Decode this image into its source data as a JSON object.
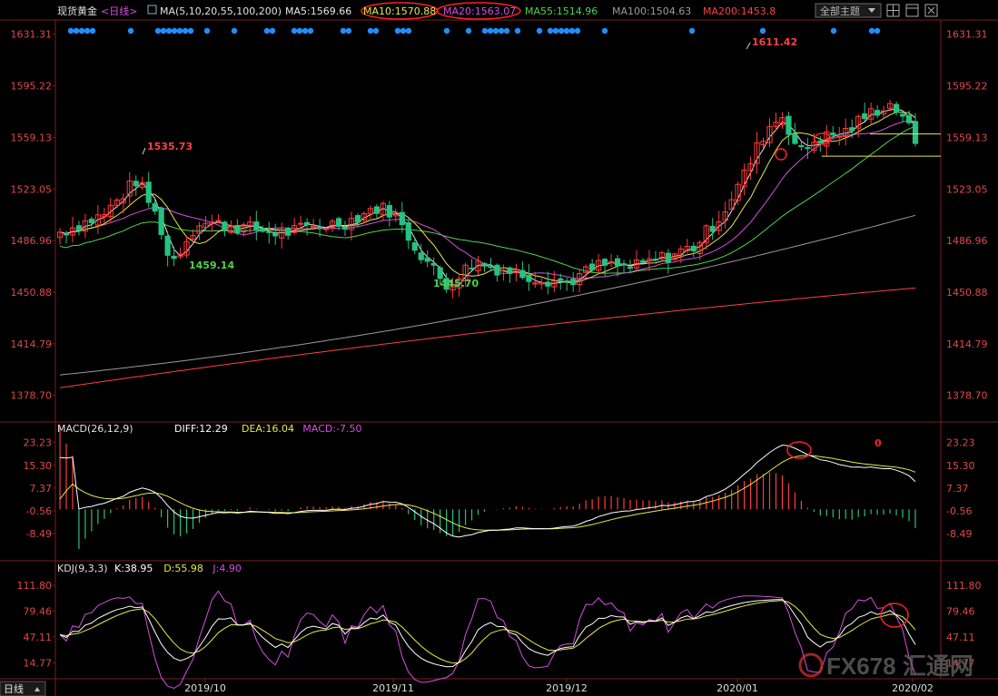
{
  "header": {
    "instrument": "现货黄金",
    "period_tag": "<日线>",
    "ma_label": "MA(5,10,20,55,100,200)",
    "ma_items": [
      {
        "text": "MA5:1569.66",
        "color": "#e6e6e6"
      },
      {
        "text": "MA10:1570.88",
        "color": "#e8e84a"
      },
      {
        "text": "MA20:1563.07",
        "color": "#d54fe0"
      },
      {
        "text": "MA55:1514.96",
        "color": "#4fd24f"
      },
      {
        "text": "MA100:1504.63",
        "color": "#9a9a9a"
      },
      {
        "text": "MA200:1453.8",
        "color": "#ff4040"
      }
    ],
    "theme_select": "全部主题",
    "toolbar_icons": [
      "grid-icon",
      "window-icon",
      "close-icon"
    ]
  },
  "colors": {
    "up": "#ff3c3c",
    "down": "#26c281",
    "ma5": "#e6e6e6",
    "ma10": "#e8e84a",
    "ma20": "#d54fe0",
    "ma55": "#4fd24f",
    "ma100": "#9a9a9a",
    "ma200": "#ff4040",
    "axis_text": "#e04848",
    "dot": "#1f8fff",
    "annot": "#ff2020",
    "diff": "#ffffff",
    "dea": "#e8e84a",
    "jline": "#d54fe0"
  },
  "chart_data": [
    {
      "type": "candlestick",
      "title": "现货黄金 日线",
      "y_ticks": [
        "1631.31",
        "1595.22",
        "1559.13",
        "1523.05",
        "1486.96",
        "1450.88",
        "1414.79",
        "1378.70"
      ],
      "ylim": [
        1362,
        1640
      ],
      "annotations": [
        {
          "text": "1611.42",
          "color": "#ff4040",
          "at": "high"
        },
        {
          "text": "1535.73",
          "color": "#ff4040",
          "at": "high"
        },
        {
          "text": "1459.14",
          "color": "#4fd24f",
          "at": "low"
        },
        {
          "text": "1445.70",
          "color": "#4fd24f",
          "at": "low"
        }
      ],
      "horizontal_levels": [
        1561.5,
        1546.0
      ],
      "series_ma": {
        "ma200": [
          1362,
          1453.8
        ],
        "ma100": [
          1392,
          1504.63
        ]
      }
    },
    {
      "type": "line",
      "title": "MACD(26,12,9)",
      "legend": [
        {
          "text": "DIFF:12.29",
          "color": "#ffffff"
        },
        {
          "text": "DEA:16.04",
          "color": "#e8e84a"
        },
        {
          "text": "MACD:-7.50",
          "color": "#d54fe0"
        }
      ],
      "y_ticks": [
        "23.23",
        "15.30",
        "7.37",
        "-0.56",
        "-8.49"
      ],
      "ylim": [
        -16,
        25
      ],
      "annotation": "0"
    },
    {
      "type": "line",
      "title": "KDJ(9,3,3)",
      "legend": [
        {
          "text": "K:38.95",
          "color": "#ffffff"
        },
        {
          "text": "D:55.98",
          "color": "#e8e84a"
        },
        {
          "text": "J:4.90",
          "color": "#d54fe0"
        }
      ],
      "y_ticks": [
        "111.80",
        "79.46",
        "47.11",
        "14.77"
      ],
      "ylim": [
        -5,
        122
      ]
    }
  ],
  "x_axis": {
    "period": "日线",
    "labels": [
      "2019/10",
      "2019/11",
      "2019/12",
      "2020/01",
      "2020/02"
    ]
  },
  "watermark": "FX678 汇通网"
}
